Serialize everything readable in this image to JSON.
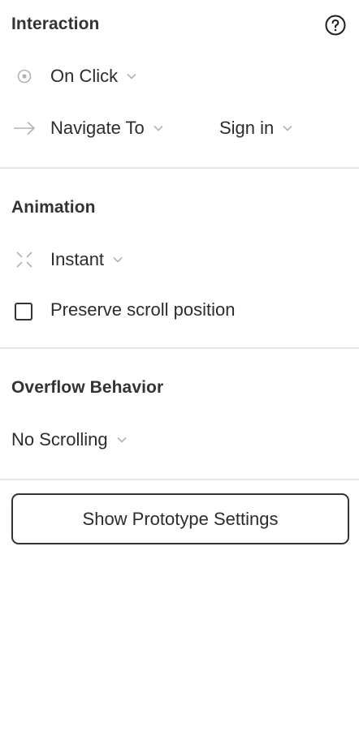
{
  "interaction": {
    "title": "Interaction",
    "help_icon": "question-circle-icon",
    "trigger": {
      "icon": "target-dot-icon",
      "label": "On Click"
    },
    "action": {
      "icon": "arrow-right-icon",
      "label": "Navigate To"
    },
    "destination": {
      "label": "Sign in"
    }
  },
  "animation": {
    "title": "Animation",
    "type": {
      "icon": "instant-collapse-icon",
      "label": "Instant"
    },
    "preserve_scroll": {
      "label": "Preserve scroll position",
      "checked": false
    }
  },
  "overflow": {
    "title": "Overflow Behavior",
    "value": {
      "label": "No Scrolling"
    }
  },
  "footer": {
    "button_label": "Show Prototype Settings"
  },
  "colors": {
    "text": "#2c2c2c",
    "heading": "#333333",
    "icon_muted": "#b3b3b3",
    "divider": "#e5e5e5"
  }
}
